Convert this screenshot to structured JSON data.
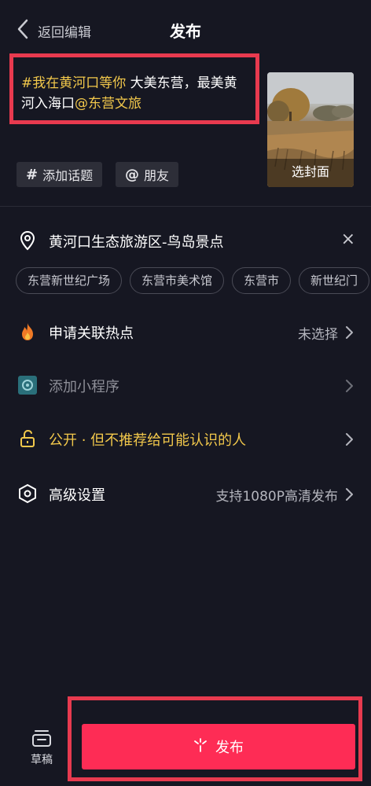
{
  "header": {
    "back_label": "返回编辑",
    "title": "发布"
  },
  "caption": {
    "topic": "#我在黄河口等你",
    "text": " 大美东营，最美黄河入海口",
    "mention": "@东营文旅"
  },
  "cover": {
    "label": "选封面"
  },
  "chips": {
    "topic_symbol": "#",
    "topic_label": "添加话题",
    "friend_symbol": "@",
    "friend_label": "朋友"
  },
  "location": {
    "name": "黄河口生态旅游区-鸟岛景点",
    "close": "×",
    "suggestions": [
      "东营新世纪广场",
      "东营市美术馆",
      "东营市",
      "新世纪门"
    ]
  },
  "rows": {
    "hotspot_label": "申请关联热点",
    "hotspot_value": "未选择",
    "miniapp_label": "添加小程序",
    "privacy_label": "公开 · 但不推荐给可能认识的人",
    "advanced_label": "高级设置",
    "advanced_value": "支持1080P高清发布"
  },
  "bottom": {
    "draft_label": "草稿",
    "publish_label": "发布"
  },
  "colors": {
    "background": "#161722",
    "highlight": "#f2c84b",
    "accent": "#fe2c55",
    "annotation": "#e83a4f"
  }
}
